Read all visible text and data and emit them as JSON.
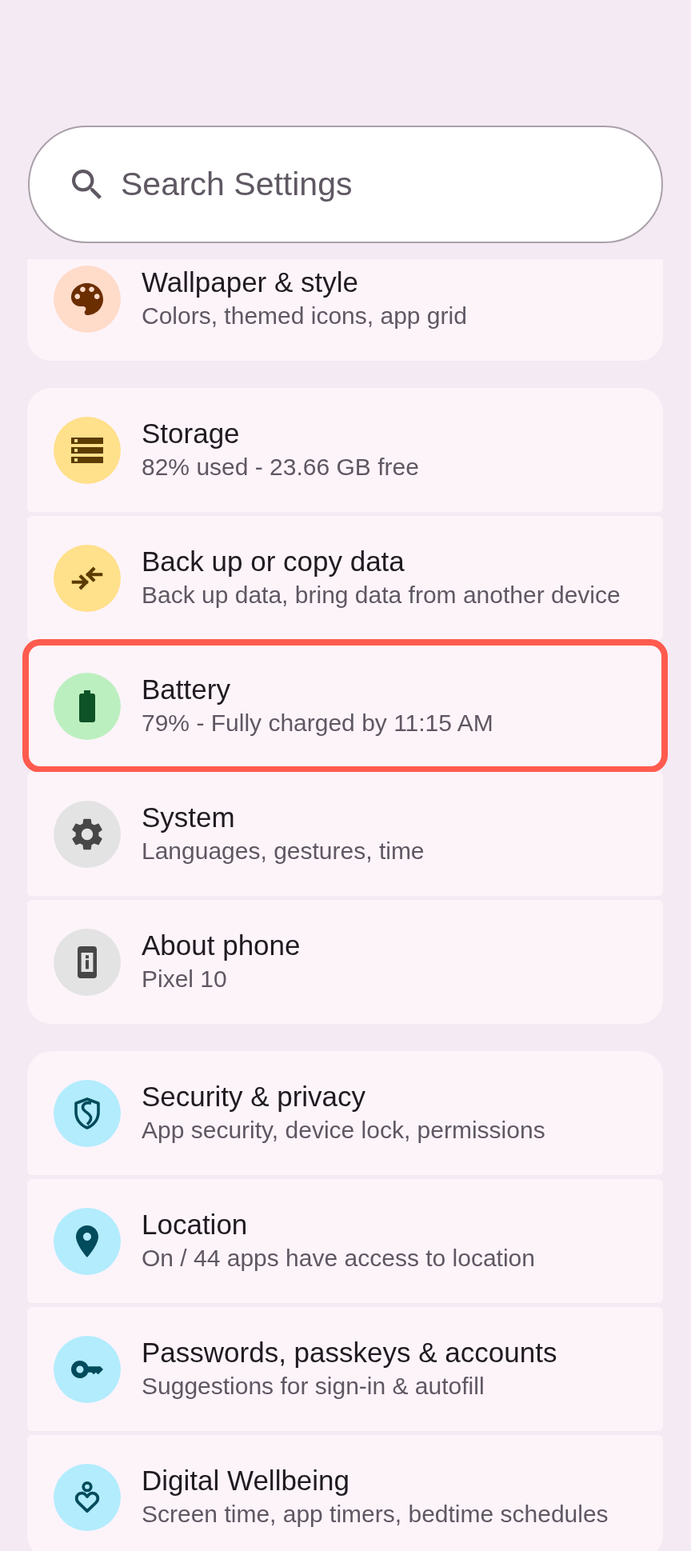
{
  "search": {
    "placeholder": "Search Settings"
  },
  "groups": [
    {
      "items": [
        {
          "title": "Wallpaper & style",
          "summary": "Colors, themed icons, app grid",
          "color": "#ffdbca",
          "highlighted": false
        }
      ]
    },
    {
      "items": [
        {
          "title": "Storage",
          "summary": "82% used - 23.66 GB free",
          "color": "#ffe08b",
          "highlighted": false
        },
        {
          "title": "Back up or copy data",
          "summary": "Back up data, bring data from another device",
          "color": "#ffe08b",
          "highlighted": false
        },
        {
          "title": "Battery",
          "summary": "79% - Fully charged by 11:15 AM",
          "color": "#bcefc0",
          "highlighted": true
        },
        {
          "title": "System",
          "summary": "Languages, gestures, time",
          "color": "#e3e3e3",
          "highlighted": false
        },
        {
          "title": "About phone",
          "summary": "Pixel 10",
          "color": "#e3e3e3",
          "highlighted": false
        }
      ]
    },
    {
      "items": [
        {
          "title": "Security & privacy",
          "summary": "App security, device lock, permissions",
          "color": "#b2ecfd",
          "highlighted": false
        },
        {
          "title": "Location",
          "summary": "On / 44 apps have access to location",
          "color": "#b2ecfd",
          "highlighted": false
        },
        {
          "title": "Passwords, passkeys & accounts",
          "summary": "Suggestions for sign-in & autofill",
          "color": "#b2ecfd",
          "highlighted": false
        },
        {
          "title": "Digital Wellbeing",
          "summary": "Screen time, app timers, bedtime schedules",
          "color": "#b2ecfd",
          "highlighted": false
        }
      ]
    }
  ]
}
